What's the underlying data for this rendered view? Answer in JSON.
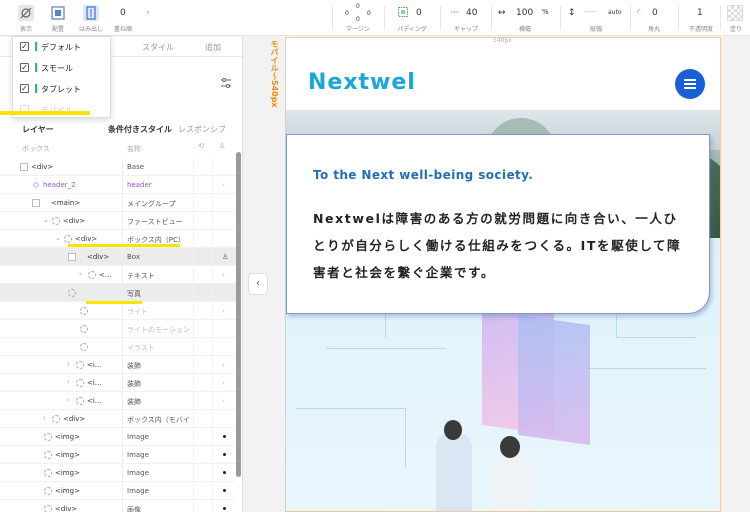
{
  "toolbar": {
    "left_items": [
      {
        "label": "表示",
        "icon": "eye-slash-icon"
      },
      {
        "label": "配置",
        "icon": "placement-icon"
      },
      {
        "label": "はみ出し",
        "icon": "overflow-icon"
      },
      {
        "label": "重ね順",
        "value": "0"
      }
    ],
    "margin": {
      "label": "マージン",
      "top": "0",
      "left": "0",
      "right": "0",
      "bottom": "0"
    },
    "padding": {
      "label": "パディング",
      "value": "0"
    },
    "gap": {
      "label": "ギャップ",
      "value": "40"
    },
    "width": {
      "label": "横幅",
      "value": "100",
      "unit": "%"
    },
    "height": {
      "label": "縦幅",
      "value": "-----",
      "unit": "auto"
    },
    "radius": {
      "label": "角丸",
      "value": "0"
    },
    "opacity": {
      "label": "不透明度",
      "value": "1"
    },
    "fill": {
      "label": "塗り"
    }
  },
  "left_panel": {
    "tabs": [
      "スタイル",
      "追加"
    ],
    "dropdown": {
      "items": [
        {
          "label": "デフォルト",
          "checked": true
        },
        {
          "label": "スモール",
          "checked": true
        },
        {
          "label": "タブレット",
          "checked": true
        },
        {
          "label": "モバイル",
          "checked": false
        }
      ]
    },
    "layers_title": "レイヤー",
    "layers_tabs": [
      "条件付きスタイル",
      "レスポンシブ"
    ],
    "columns": {
      "box": "ボックス",
      "name": "名称"
    },
    "tree": [
      {
        "name": "<div>",
        "label": "Base",
        "indent": 0
      },
      {
        "name": "header_2",
        "label": "header",
        "indent": 1,
        "purple": true
      },
      {
        "name": "<main>",
        "label": "メイングループ",
        "indent": 1
      },
      {
        "name": "<div>",
        "label": "ファーストビュー",
        "indent": 2
      },
      {
        "name": "<div>",
        "label": "ボックス内（PC）",
        "indent": 3
      },
      {
        "name": "<div>",
        "label": "Box",
        "indent": 4
      },
      {
        "name": "<...",
        "label": "テキスト",
        "indent": 5
      },
      {
        "name": "",
        "label": "写真",
        "indent": 4
      },
      {
        "name": "",
        "label": "ライト",
        "indent": 5
      },
      {
        "name": "",
        "label": "ライトのモーション",
        "indent": 5
      },
      {
        "name": "",
        "label": "イラスト",
        "indent": 5
      },
      {
        "name": "<i...",
        "label": "装飾",
        "indent": 4
      },
      {
        "name": "<i...",
        "label": "装飾",
        "indent": 4
      },
      {
        "name": "<i...",
        "label": "装飾",
        "indent": 4
      },
      {
        "name": "<div>",
        "label": "ボックス内（モバイ",
        "indent": 2
      },
      {
        "name": "<img>",
        "label": "Image",
        "indent": 2
      },
      {
        "name": "<img>",
        "label": "Image",
        "indent": 2
      },
      {
        "name": "<img>",
        "label": "Image",
        "indent": 2
      },
      {
        "name": "<img>",
        "label": "Image",
        "indent": 2
      },
      {
        "name": "<div>",
        "label": "画像",
        "indent": 2
      }
    ]
  },
  "canvas": {
    "breakpoint_label": "モバイル～540px",
    "ruler_text": "540px",
    "logo": "Nextwel",
    "subtitle": "To the Next well-being society.",
    "body_text": "Nextwelは障害のある方の就労問題に向き合い、一人ひとりが自分らしく働ける仕組みをつくる。ITを駆使して障害者と社会を繋ぐ企業です。"
  },
  "colors": {
    "brand": "#19a6d8",
    "accent_blue": "#1a5fd8",
    "highlight": "#f7e400",
    "breakpoint": "#f08c00"
  }
}
